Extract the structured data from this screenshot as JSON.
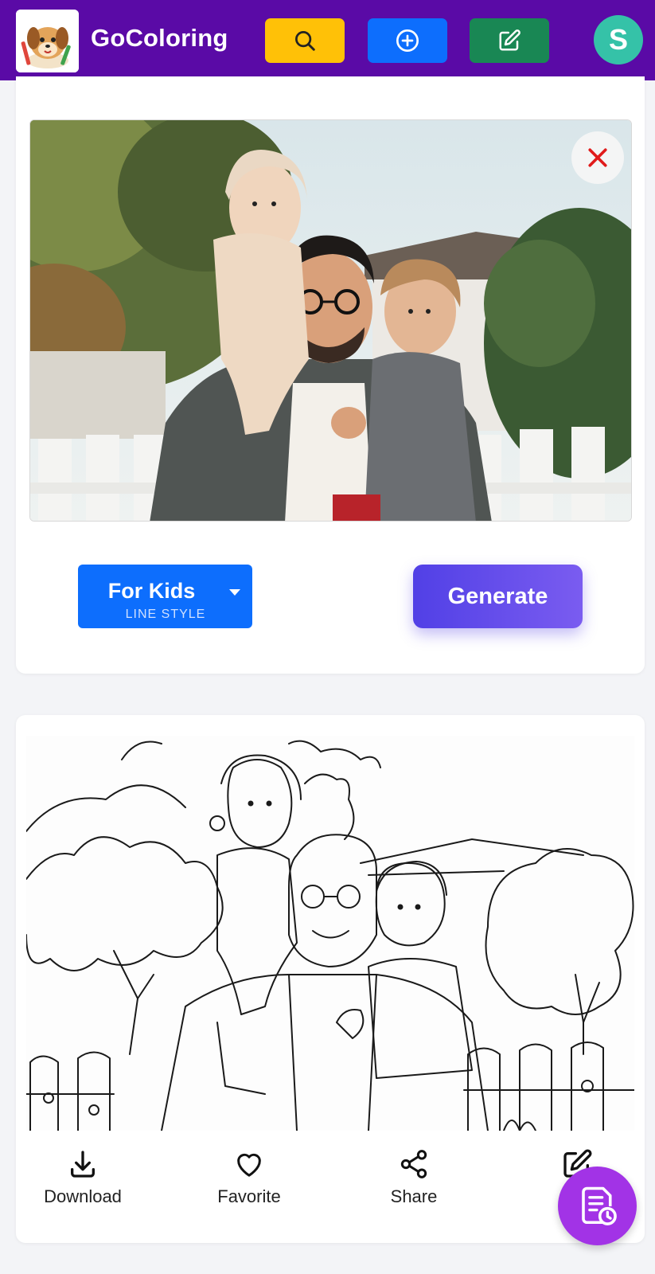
{
  "header": {
    "brand": "GoColoring",
    "avatar_initial": "S",
    "icons": {
      "search": "search-icon",
      "create": "plus-circle-icon",
      "edit": "pencil-square-icon"
    },
    "colors": {
      "bar": "#5a0aa6",
      "search": "#ffc107",
      "create": "#0d6efd",
      "edit": "#198754",
      "avatar": "#35c2a8"
    }
  },
  "upload": {
    "photo": "family-photo",
    "close_icon": "close-icon"
  },
  "controls": {
    "style_value": "For Kids",
    "style_caption": "LINE STYLE",
    "generate_label": "Generate"
  },
  "result": {
    "image": "coloring-page-lineart",
    "actions": [
      {
        "label": "Download",
        "icon": "download-icon"
      },
      {
        "label": "Favorite",
        "icon": "heart-icon"
      },
      {
        "label": "Share",
        "icon": "share-icon"
      },
      {
        "label": "",
        "icon": "edit-icon"
      }
    ]
  },
  "fab": {
    "icon": "history-document-icon",
    "color": "#a233e6"
  }
}
